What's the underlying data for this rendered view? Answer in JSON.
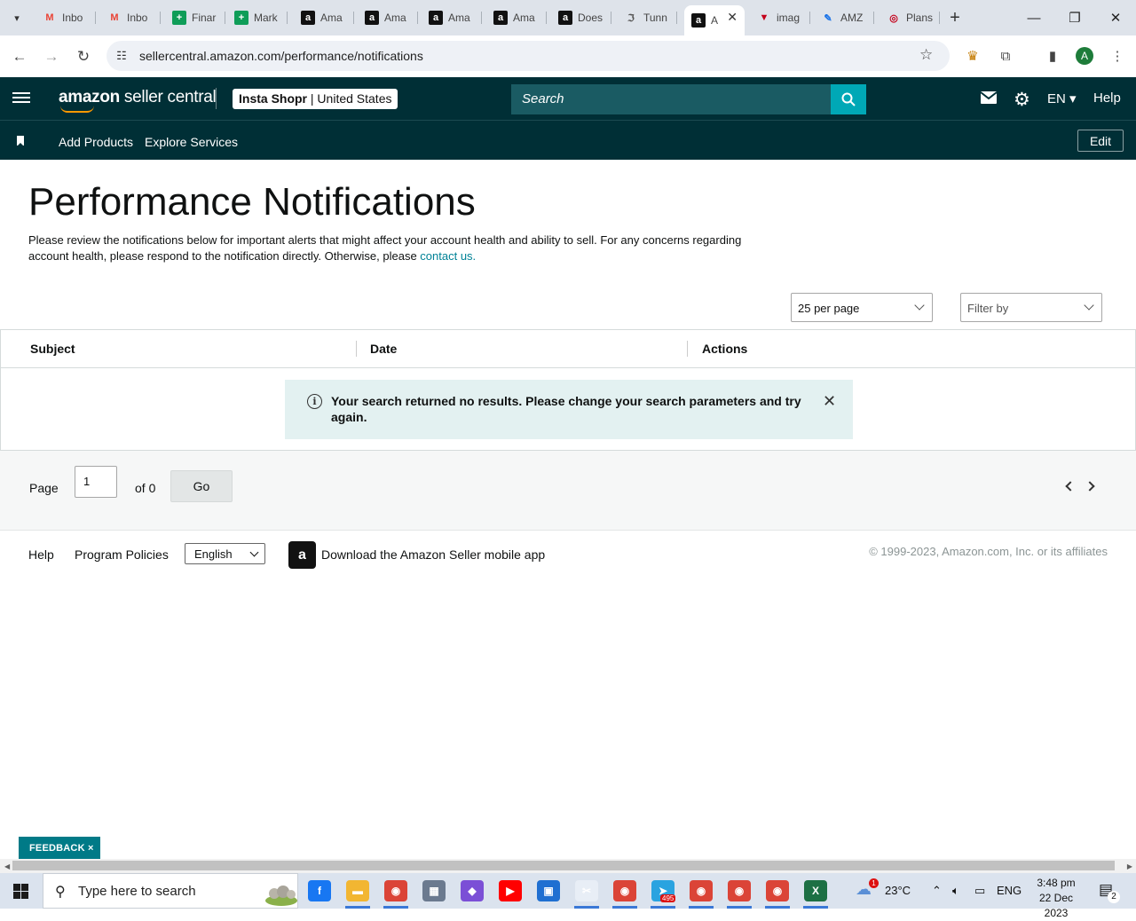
{
  "browser": {
    "tabs": [
      {
        "label": "Inbo",
        "icon": "gmail-icon",
        "color": "#ea4335"
      },
      {
        "label": "Inbo",
        "icon": "gmail-icon",
        "color": "#ea4335"
      },
      {
        "label": "Finar",
        "icon": "sheets-icon",
        "color": "#0f9d58"
      },
      {
        "label": "Mark",
        "icon": "sheets-icon",
        "color": "#0f9d58"
      },
      {
        "label": "Ama",
        "icon": "amazon-icon",
        "color": "#111111"
      },
      {
        "label": "Ama",
        "icon": "amazon-icon",
        "color": "#111111"
      },
      {
        "label": "Ama",
        "icon": "amazon-icon",
        "color": "#111111"
      },
      {
        "label": "Ama",
        "icon": "amazon-icon",
        "color": "#111111"
      },
      {
        "label": "Does",
        "icon": "amazon-icon",
        "color": "#111111"
      },
      {
        "label": "Tunn",
        "icon": "tunnel-icon",
        "color": "#555555"
      },
      {
        "label": "A",
        "icon": "amazon-icon",
        "color": "#111111",
        "active": true
      },
      {
        "label": "imag",
        "icon": "image-site-icon",
        "color": "#c4001a"
      },
      {
        "label": "AMZ",
        "icon": "pencil-app-icon",
        "color": "#1a73e8"
      },
      {
        "label": "Plans",
        "icon": "plans-site-icon",
        "color": "#c4001a"
      }
    ],
    "url": "sellercentral.amazon.com/performance/notifications",
    "profile_initial": "A"
  },
  "header": {
    "logo_bold": "amazon",
    "logo_rest": " seller central",
    "store_name": "Insta Shopr",
    "store_region": " | United States",
    "search_placeholder": "Search",
    "language": "EN",
    "help": "Help"
  },
  "subnav": {
    "links": [
      "Add Products",
      "Explore Services"
    ],
    "edit": "Edit"
  },
  "page": {
    "title": "Performance Notifications",
    "intro": "Please review the notifications below for important alerts that might affect your account health and ability to sell. For any concerns regarding account health, please respond to the notification directly. Otherwise, please ",
    "intro_link": "contact us.",
    "per_page": "25 per page",
    "filter": "Filter by",
    "columns": [
      "Subject",
      "Date",
      "Actions"
    ],
    "alert": "Your search returned no results. Please change your search parameters and try again."
  },
  "pagination": {
    "page_label": "Page",
    "page_value": "1",
    "of_label": "of 0",
    "go": "Go"
  },
  "footer": {
    "help": "Help",
    "policies": "Program Policies",
    "language": "English",
    "app_text": "Download the Amazon Seller mobile app",
    "copyright": "© 1999-2023, Amazon.com, Inc. or its affiliates"
  },
  "feedback": "FEEDBACK ×",
  "taskbar": {
    "search_placeholder": "Type here to search",
    "weather": "23°C",
    "language": "ENG",
    "time": "3:48 pm",
    "date": "22 Dec 2023",
    "notifications": "2",
    "telegram_badge": "495",
    "weather_badge": "1"
  }
}
